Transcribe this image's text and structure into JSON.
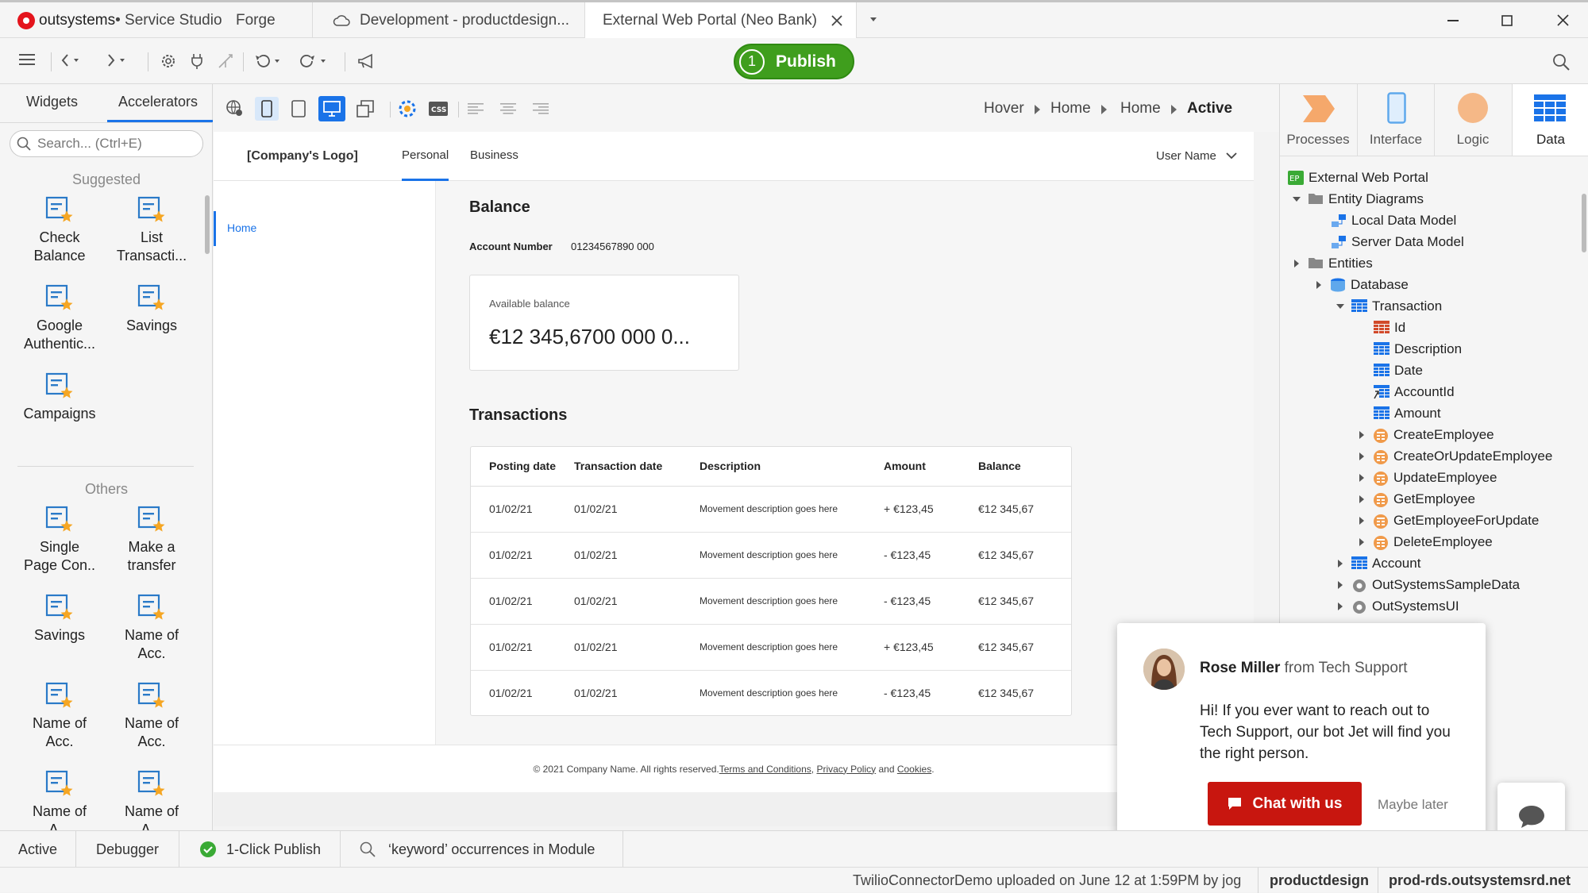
{
  "app": {
    "brand": "outsystems",
    "product": " • Service Studio",
    "brand_color": "#e4141c"
  },
  "tabs": [
    {
      "label": "Forge"
    },
    {
      "label": "Development - productdesign..."
    },
    {
      "label": "External Web Portal (Neo Bank)"
    }
  ],
  "toolbar": {
    "publish_number": "1",
    "publish_label": "Publish"
  },
  "left_panel": {
    "tabs": [
      "Widgets",
      "Accelerators"
    ],
    "active_tab": "Accelerators",
    "search_placeholder": "Search... (Ctrl+E)",
    "suggested_title": "Suggested",
    "suggested": [
      {
        "line1": "Check",
        "line2": "Balance"
      },
      {
        "line1": "List",
        "line2": "Transacti..."
      },
      {
        "line1": "Google",
        "line2": "Authentic..."
      },
      {
        "line1": "Savings",
        "line2": ""
      },
      {
        "line1": "Campaigns",
        "line2": ""
      }
    ],
    "others_title": "Others",
    "others": [
      {
        "line1": "Single",
        "line2": "Page Con.."
      },
      {
        "line1": "Make a",
        "line2": "transfer"
      },
      {
        "line1": "Savings",
        "line2": ""
      },
      {
        "line1": "Name of",
        "line2": "Acc."
      },
      {
        "line1": "Name of",
        "line2": "Acc."
      },
      {
        "line1": "Name of",
        "line2": "Acc."
      },
      {
        "line1": "Name of",
        "line2": "A..."
      },
      {
        "line1": "Name of",
        "line2": "A..."
      }
    ]
  },
  "breadcrumb": [
    "Hover",
    "Home",
    "Home",
    "Active"
  ],
  "webapp": {
    "logo": "[Company's Logo]",
    "nav": [
      "Personal",
      "Business"
    ],
    "user_menu": "User Name",
    "side_menu": [
      "Home"
    ],
    "balance_title": "Balance",
    "account_number_label": "Account Number",
    "account_number_value": "01234567890 000",
    "available_label": "Available balance",
    "available_value": "€12 345,6700 000 0...",
    "transactions_title": "Transactions",
    "table": {
      "headers": [
        "Posting date",
        "Transaction date",
        "Description",
        "Amount",
        "Balance"
      ],
      "rows": [
        {
          "posting": "01/02/21",
          "transaction": "01/02/21",
          "description": "Movement description goes here",
          "amount": "+ €123,45",
          "balance": "€12 345,67",
          "positive": true
        },
        {
          "posting": "01/02/21",
          "transaction": "01/02/21",
          "description": "Movement description goes here",
          "amount": "- €123,45",
          "balance": "€12 345,67",
          "positive": false
        },
        {
          "posting": "01/02/21",
          "transaction": "01/02/21",
          "description": "Movement description goes here",
          "amount": "- €123,45",
          "balance": "€12 345,67",
          "positive": false
        },
        {
          "posting": "01/02/21",
          "transaction": "01/02/21",
          "description": "Movement description goes here",
          "amount": "+ €123,45",
          "balance": "€12 345,67",
          "positive": true
        },
        {
          "posting": "01/02/21",
          "transaction": "01/02/21",
          "description": "Movement description goes here",
          "amount": "- €123,45",
          "balance": "€12 345,67",
          "positive": false
        }
      ]
    },
    "footer": {
      "copyright": "© 2021 Company Name. All rights reserved. ",
      "terms": "Terms and Conditions",
      "sep": ", ",
      "privacy": "Privacy Policy",
      "and": " and ",
      "cookies": "Cookies",
      "end": "."
    }
  },
  "right_panel": {
    "tabs": [
      "Processes",
      "Interface",
      "Logic",
      "Data"
    ],
    "active_tab": "Data",
    "tree": [
      {
        "label": "External Web Portal",
        "icon": "ep-badge",
        "level": 0,
        "twisty": "none"
      },
      {
        "label": "Entity Diagrams",
        "icon": "folder",
        "level": 1,
        "twisty": "open"
      },
      {
        "label": "Local Data Model",
        "icon": "diagram",
        "level": 2,
        "twisty": "none"
      },
      {
        "label": "Server Data Model",
        "icon": "diagram",
        "level": 2,
        "twisty": "none"
      },
      {
        "label": "Entities",
        "icon": "folder",
        "level": 1,
        "twisty": "closed"
      },
      {
        "label": "Database",
        "icon": "database",
        "level": 2,
        "twisty": "closed"
      },
      {
        "label": "Transaction",
        "icon": "entity",
        "level": 3,
        "twisty": "open"
      },
      {
        "label": "Id",
        "icon": "attr-id",
        "level": 4,
        "twisty": "none"
      },
      {
        "label": "Description",
        "icon": "attr",
        "level": 4,
        "twisty": "none"
      },
      {
        "label": "Date",
        "icon": "attr",
        "level": 4,
        "twisty": "none"
      },
      {
        "label": "AccountId",
        "icon": "attr-ref",
        "level": 4,
        "twisty": "none"
      },
      {
        "label": "Amount",
        "icon": "attr",
        "level": 4,
        "twisty": "none"
      },
      {
        "label": "CreateEmployee",
        "icon": "action",
        "level": 4,
        "twisty": "closed"
      },
      {
        "label": "CreateOrUpdateEmployee",
        "icon": "action",
        "level": 4,
        "twisty": "closed"
      },
      {
        "label": "UpdateEmployee",
        "icon": "action",
        "level": 4,
        "twisty": "closed"
      },
      {
        "label": "GetEmployee",
        "icon": "action",
        "level": 4,
        "twisty": "closed"
      },
      {
        "label": "GetEmployeeForUpdate",
        "icon": "action",
        "level": 4,
        "twisty": "closed"
      },
      {
        "label": "DeleteEmployee",
        "icon": "action",
        "level": 4,
        "twisty": "closed"
      },
      {
        "label": "Account",
        "icon": "entity",
        "level": 3,
        "twisty": "closed"
      },
      {
        "label": "OutSystemsSampleData",
        "icon": "module",
        "level": 3,
        "twisty": "closed"
      },
      {
        "label": "OutSystemsUI",
        "icon": "module",
        "level": 3,
        "twisty": "closed"
      }
    ]
  },
  "chat": {
    "name": "Rose Miller",
    "from": " from Tech Support",
    "message": "Hi! If you ever want to reach out to Tech Support, our bot Jet will find you the right person.",
    "cta": "Chat with us",
    "dismiss": "Maybe later",
    "cta_color": "#c8160f"
  },
  "bottom_bar": {
    "active": "Active",
    "debugger": "Debugger",
    "publish": "1-Click Publish",
    "search": "‘keyword’ occurrences in Module"
  },
  "status_bar": {
    "message": "TwilioConnectorDemo uploaded on June 12 at 1:59PM by jog",
    "env": "productdesign",
    "server": "prod-rds.outsystemsrd.net"
  },
  "colors": {
    "accent_blue": "#1a73e8",
    "publish_green": "#3f9e1d",
    "positive_amount": "#3aaa35"
  }
}
